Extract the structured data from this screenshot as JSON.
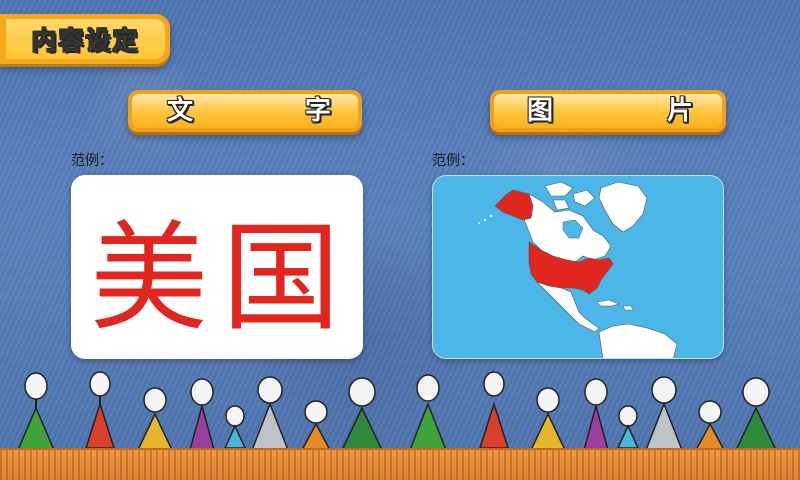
{
  "header": {
    "title": "内容设定"
  },
  "sections": {
    "text": {
      "button_chars": [
        "文",
        "字"
      ],
      "example_label": "范例：",
      "example_text": "美国"
    },
    "image": {
      "button_chars": [
        "图",
        "片"
      ],
      "example_label": "范例：",
      "map_subject": "North America map with United States highlighted"
    }
  },
  "colors": {
    "background": "#5a80bd",
    "button_orange": "#f0a020",
    "button_highlight": "#ffc53c",
    "example_text_red": "#e0261f",
    "map_water": "#4cb6e8",
    "map_land": "#ffffff",
    "map_highlight": "#e0261f",
    "ground": "#e08533"
  },
  "icons": {
    "decoration": "stick-figure-people-row"
  }
}
